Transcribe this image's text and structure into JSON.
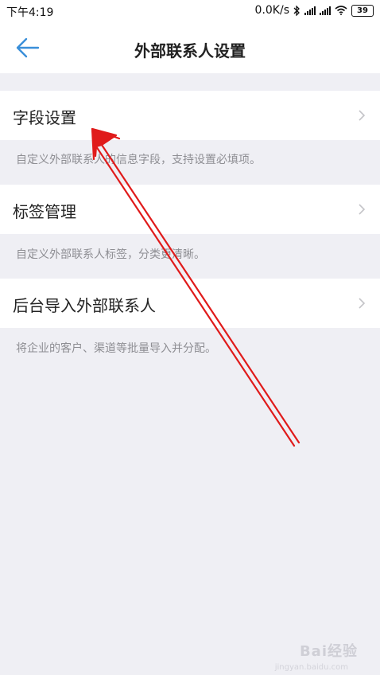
{
  "status_bar": {
    "time": "下午4:19",
    "network_speed": "0.0K/s",
    "battery": "39"
  },
  "header": {
    "title": "外部联系人设置"
  },
  "settings": [
    {
      "label": "字段设置",
      "description": "自定义外部联系人的信息字段，支持设置必填项。"
    },
    {
      "label": "标签管理",
      "description": "自定义外部联系人标签，分类更清晰。"
    },
    {
      "label": "后台导入外部联系人",
      "description": "将企业的客户、渠道等批量导入并分配。"
    }
  ],
  "watermark": {
    "brand": "Bai经验",
    "url": "jingyan.baidu.com"
  },
  "colors": {
    "accent": "#3a8fd9",
    "background": "#efeff4",
    "annotation": "#e01b1b"
  }
}
